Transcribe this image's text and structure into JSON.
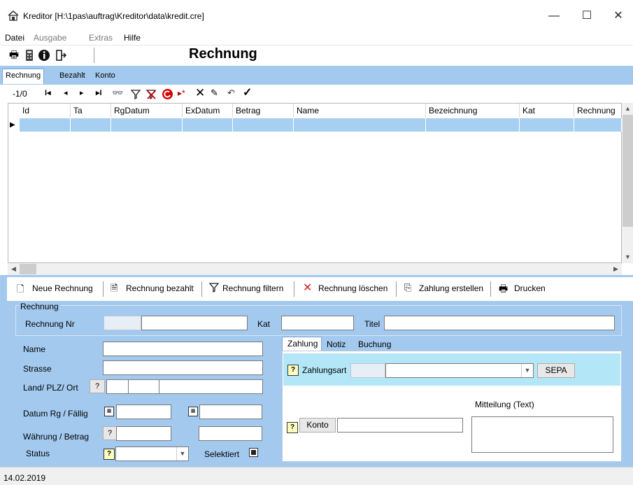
{
  "window": {
    "title": "Kreditor [H:\\1pas\\auftrag\\Kreditor\\data\\kredit.cre]",
    "minimize": "—",
    "maximize": "☐",
    "close": "✕"
  },
  "menu": {
    "items": [
      "Datei",
      "Ausgabe",
      "Extras",
      "Hilfe"
    ]
  },
  "header": {
    "title": "Rechnung"
  },
  "tabs": [
    "Rechnung",
    "Bezahlt",
    "Konto"
  ],
  "nav": {
    "record_pos": "-1/0",
    "first": "⏮",
    "prev": "◀",
    "next": "▶",
    "last": "⏭"
  },
  "grid": {
    "columns": [
      "Id",
      "Ta",
      "RgDatum",
      "ExDatum",
      "Betrag",
      "Name",
      "Bezeichnung",
      "Kat",
      "Rechnung"
    ]
  },
  "actions": {
    "new": "Neue Rechnung",
    "paid": "Rechnung bezahlt",
    "filter": "Rechnung filtern",
    "delete": "Rechnung löschen",
    "payment": "Zahlung erstellen",
    "print": "Drucken"
  },
  "form": {
    "group_label": "Rechnung",
    "rechnung_nr": "Rechnung Nr",
    "kat": "Kat",
    "titel": "Titel",
    "name": "Name",
    "strasse": "Strasse",
    "land_plz_ort": "Land/ PLZ/ Ort",
    "datum": "Datum Rg / Fällig",
    "waehrung": "Währung / Betrag",
    "status": "Status",
    "selektiert": "Selektiert",
    "qmark": "?"
  },
  "subtabs": [
    "Zahlung",
    "Notiz",
    "Buchung"
  ],
  "zahlung": {
    "zahlungsart": "Zahlungsart",
    "sepa": "SEPA",
    "mitteilung": "Mitteilung (Text)",
    "konto": "Konto"
  },
  "statusbar": {
    "date": "14.02.2019"
  }
}
